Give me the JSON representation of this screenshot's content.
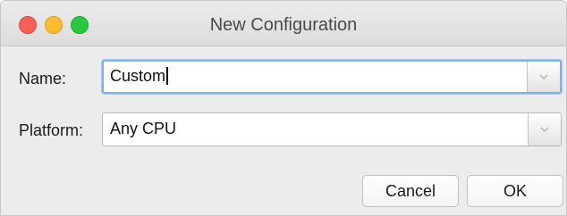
{
  "window": {
    "title": "New Configuration",
    "traffic_lights": [
      "close",
      "minimize",
      "zoom"
    ]
  },
  "form": {
    "name_label": "Name:",
    "name_value": "Custom",
    "platform_label": "Platform:",
    "platform_value": "Any CPU"
  },
  "buttons": {
    "cancel_label": "Cancel",
    "ok_label": "OK"
  },
  "colors": {
    "close": "#fc5f57",
    "minimize": "#fdbc2e",
    "zoom": "#28c941",
    "focus_ring": "#7fb1ee"
  },
  "icons": {
    "dropdown": "chevron-down-icon"
  }
}
